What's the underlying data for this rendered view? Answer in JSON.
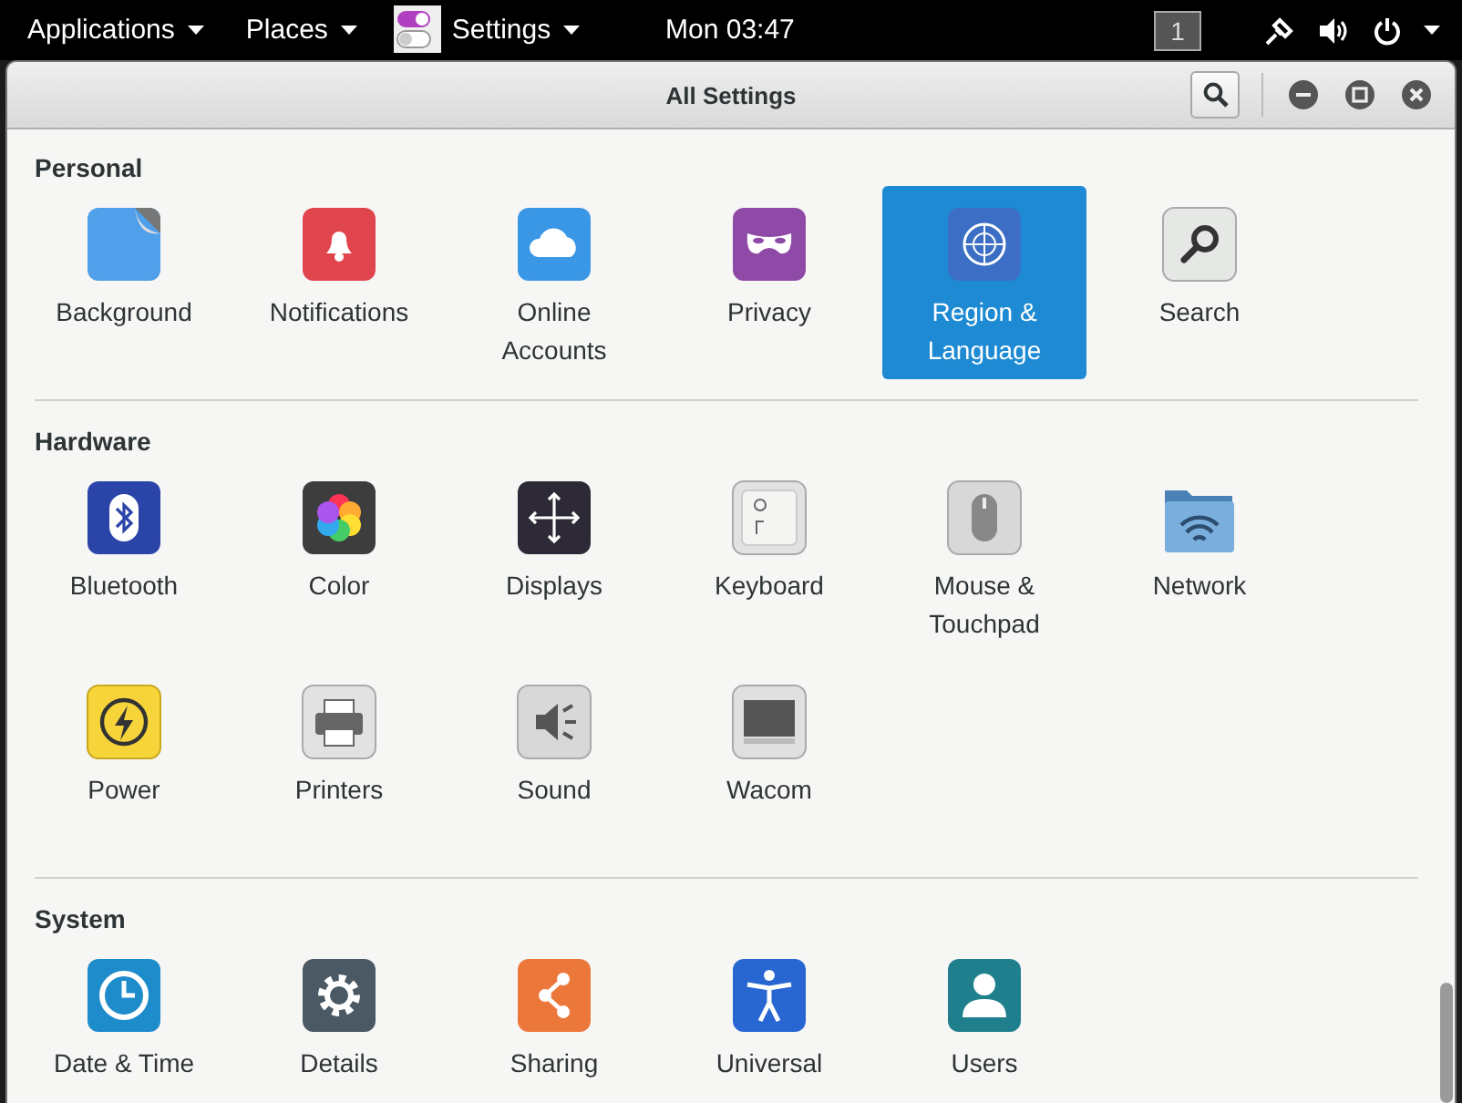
{
  "top_bar": {
    "menus": [
      {
        "label": "Applications",
        "kind": "plain"
      },
      {
        "label": "Places",
        "kind": "plain"
      },
      {
        "label": "Settings",
        "kind": "app"
      }
    ],
    "clock": "Mon 03:47",
    "workspace": "1"
  },
  "window": {
    "title": "All Settings"
  },
  "sections": [
    {
      "title": "Personal",
      "items": [
        {
          "label": "Background",
          "selected": false
        },
        {
          "label": "Notifications",
          "selected": false
        },
        {
          "label": "Online Accounts",
          "selected": false
        },
        {
          "label": "Privacy",
          "selected": false
        },
        {
          "label": "Region & Language",
          "selected": true
        },
        {
          "label": "Search",
          "selected": false
        }
      ]
    },
    {
      "title": "Hardware",
      "items": [
        {
          "label": "Bluetooth",
          "selected": false
        },
        {
          "label": "Color",
          "selected": false
        },
        {
          "label": "Displays",
          "selected": false
        },
        {
          "label": "Keyboard",
          "selected": false
        },
        {
          "label": "Mouse & Touchpad",
          "selected": false
        },
        {
          "label": "Network",
          "selected": false
        },
        {
          "label": "Power",
          "selected": false
        },
        {
          "label": "Printers",
          "selected": false
        },
        {
          "label": "Sound",
          "selected": false
        },
        {
          "label": "Wacom",
          "selected": false
        }
      ]
    },
    {
      "title": "System",
      "items": [
        {
          "label": "Date & Time",
          "selected": false
        },
        {
          "label": "Details",
          "selected": false
        },
        {
          "label": "Sharing",
          "selected": false
        },
        {
          "label": "Universal",
          "selected": false
        },
        {
          "label": "Users",
          "selected": false
        }
      ]
    }
  ]
}
